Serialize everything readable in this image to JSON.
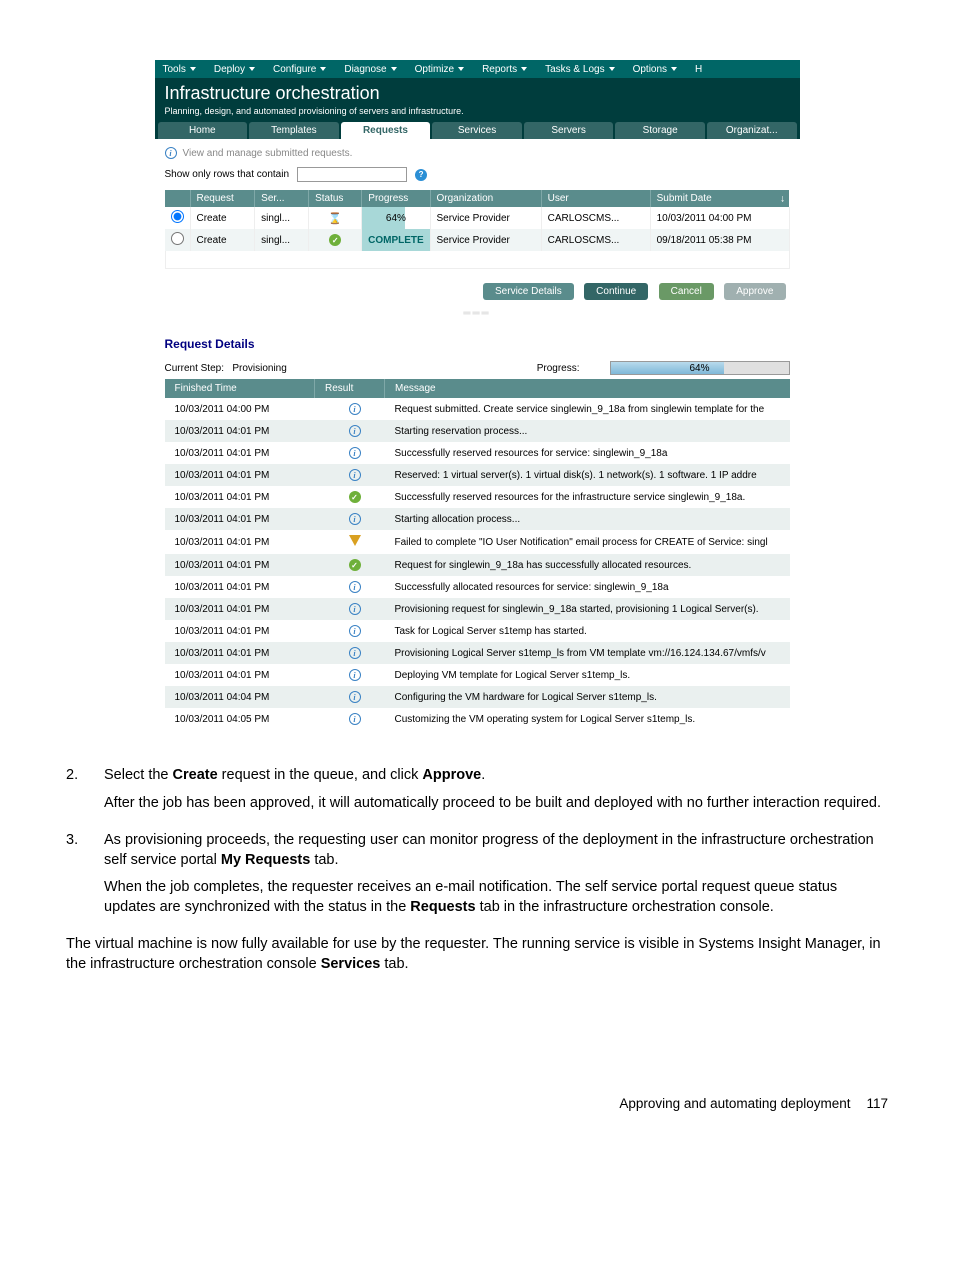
{
  "menubar": [
    "Tools",
    "Deploy",
    "Configure",
    "Diagnose",
    "Optimize",
    "Reports",
    "Tasks & Logs",
    "Options",
    "H"
  ],
  "header": {
    "title": "Infrastructure orchestration",
    "subtitle": "Planning, design, and automated provisioning of servers and infrastructure."
  },
  "tabs": [
    "Home",
    "Templates",
    "Requests",
    "Services",
    "Servers",
    "Storage",
    "Organizat..."
  ],
  "info_line": "View and manage submitted requests.",
  "filter_label": "Show only rows that contain",
  "req_columns": [
    "",
    "Request",
    "Ser...",
    "Status",
    "Progress",
    "Organization",
    "User",
    "Submit Date"
  ],
  "req_rows": [
    {
      "selected": true,
      "request": "Create",
      "ser": "singl...",
      "status": "hourglass",
      "progress": "64%",
      "progress_class": "progress-64",
      "org": "Service Provider",
      "user": "CARLOSCMS...",
      "date": "10/03/2011 04:00 PM"
    },
    {
      "selected": false,
      "request": "Create",
      "ser": "singl...",
      "status": "check",
      "progress": "COMPLETE",
      "progress_class": "progress-complete",
      "org": "Service Provider",
      "user": "CARLOSCMS...",
      "date": "09/18/2011 05:38 PM"
    }
  ],
  "actions": {
    "service_details": "Service Details",
    "continue": "Continue",
    "cancel": "Cancel",
    "approve": "Approve"
  },
  "details": {
    "title": "Request Details",
    "current_step_label": "Current Step:",
    "current_step_value": "Provisioning",
    "progress_label": "Progress:",
    "progress_value": "64%"
  },
  "details_columns": [
    "Finished Time",
    "Result",
    "Message"
  ],
  "details_rows": [
    {
      "time": "10/03/2011 04:00 PM",
      "result": "info",
      "msg": "Request submitted. Create service singlewin_9_18a from singlewin template for the"
    },
    {
      "time": "10/03/2011 04:01 PM",
      "result": "info",
      "msg": "Starting reservation process..."
    },
    {
      "time": "10/03/2011 04:01 PM",
      "result": "info",
      "msg": "Successfully reserved resources for service: singlewin_9_18a"
    },
    {
      "time": "10/03/2011 04:01 PM",
      "result": "info",
      "msg": "Reserved: 1 virtual server(s). 1 virtual disk(s). 1 network(s). 1 software. 1 IP addre"
    },
    {
      "time": "10/03/2011 04:01 PM",
      "result": "check",
      "msg": "Successfully reserved resources for the infrastructure service singlewin_9_18a."
    },
    {
      "time": "10/03/2011 04:01 PM",
      "result": "info",
      "msg": "Starting allocation process..."
    },
    {
      "time": "10/03/2011 04:01 PM",
      "result": "warn",
      "msg": "Failed to complete \"IO User Notification\" email process for CREATE of Service: singl"
    },
    {
      "time": "10/03/2011 04:01 PM",
      "result": "check",
      "msg": "Request for singlewin_9_18a has successfully allocated resources."
    },
    {
      "time": "10/03/2011 04:01 PM",
      "result": "info",
      "msg": "Successfully allocated resources for service: singlewin_9_18a"
    },
    {
      "time": "10/03/2011 04:01 PM",
      "result": "info",
      "msg": "Provisioning request for singlewin_9_18a started, provisioning 1 Logical Server(s)."
    },
    {
      "time": "10/03/2011 04:01 PM",
      "result": "info",
      "msg": "Task for Logical Server s1temp has started."
    },
    {
      "time": "10/03/2011 04:01 PM",
      "result": "info",
      "msg": "Provisioning Logical Server s1temp_ls from VM template vm://16.124.134.67/vmfs/v"
    },
    {
      "time": "10/03/2011 04:01 PM",
      "result": "info",
      "msg": "Deploying VM template for Logical Server s1temp_ls."
    },
    {
      "time": "10/03/2011 04:04 PM",
      "result": "info",
      "msg": "Configuring the VM hardware for Logical Server s1temp_ls."
    },
    {
      "time": "10/03/2011 04:05 PM",
      "result": "info",
      "msg": "Customizing the VM operating system for Logical Server s1temp_ls."
    }
  ],
  "doc": {
    "step2_num": "2.",
    "step2_a": "Select the ",
    "step2_b": "Create",
    "step2_c": " request in the queue, and click ",
    "step2_d": "Approve",
    "step2_e": ".",
    "step2_p2": "After the job has been approved, it will automatically proceed to be built and deployed with no further interaction required.",
    "step3_num": "3.",
    "step3_a": "As provisioning proceeds, the requesting user can monitor progress of the deployment in the infrastructure orchestration self service portal ",
    "step3_b": "My Requests",
    "step3_c": " tab.",
    "step3_p2a": "When the job completes, the requester receives an e-mail notification. The self service portal request queue status updates are synchronized with the status in the ",
    "step3_p2b": "Requests",
    "step3_p2c": " tab in the infrastructure orchestration console.",
    "final_a": "The virtual machine is now fully available for use by the requester. The running service is visible in Systems Insight Manager, in the infrastructure orchestration console ",
    "final_b": "Services",
    "final_c": " tab.",
    "footer_text": "Approving and automating deployment",
    "footer_page": "117"
  }
}
